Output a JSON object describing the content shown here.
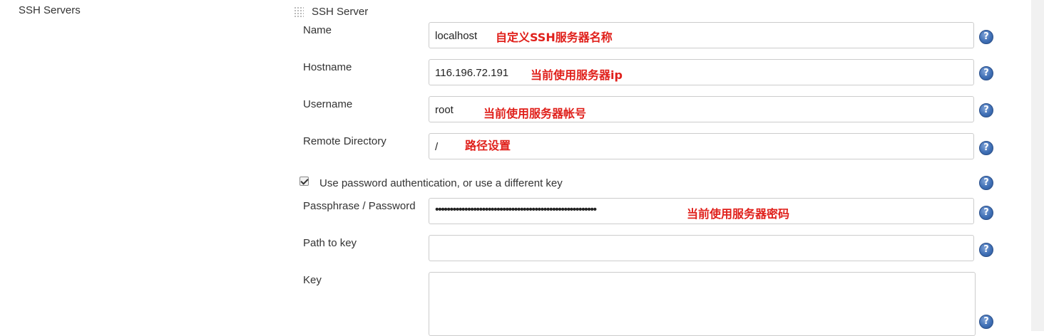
{
  "section": {
    "label": "SSH Servers"
  },
  "server": {
    "title": "SSH Server"
  },
  "fields": {
    "name": {
      "label": "Name",
      "value": "localhost",
      "annotation": "自定义SSH服务器名称"
    },
    "hostname": {
      "label": "Hostname",
      "value": "116.196.72.191",
      "annotation": "当前使用服务器ip"
    },
    "username": {
      "label": "Username",
      "value": "root",
      "annotation": "当前使用服务器帐号"
    },
    "remote_directory": {
      "label": "Remote Directory",
      "value": "/",
      "annotation": "路径设置"
    },
    "use_password": {
      "label": "Use password authentication, or use a different key",
      "checked": true
    },
    "passphrase": {
      "label": "Passphrase / Password",
      "value": "•••••••••••••••••••••••••••••••••••••••••••••••••••••••",
      "annotation": "当前使用服务器密码"
    },
    "path_to_key": {
      "label": "Path to key",
      "value": ""
    },
    "key": {
      "label": "Key",
      "value": ""
    }
  },
  "help": {
    "glyph": "?",
    "icon": "help-icon"
  },
  "colors": {
    "annotation": "#e0201b",
    "help": "#3f6fb5",
    "border": "#cccccc"
  }
}
